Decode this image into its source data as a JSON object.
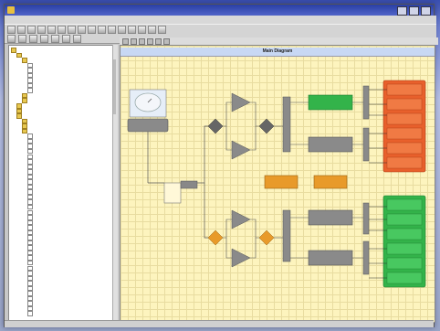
{
  "window": {
    "title": ""
  },
  "menu": [],
  "diagram": {
    "title": "Main Diagram"
  },
  "colors": {
    "green": "#33b34a",
    "orange_red": "#e8602c",
    "orange": "#e89a2a",
    "gray": "#8a8a8a",
    "grid": "#fdf4be"
  }
}
